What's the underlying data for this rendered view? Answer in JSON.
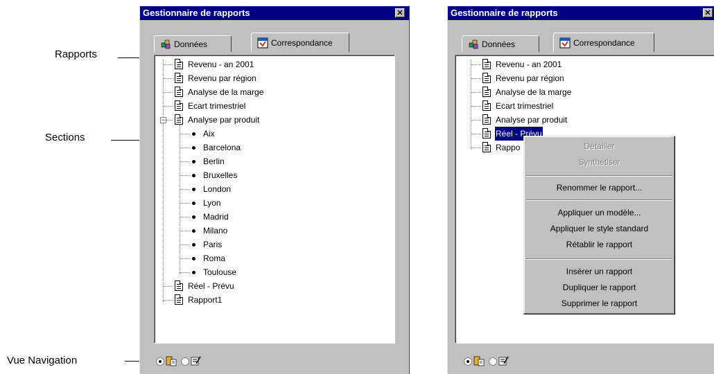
{
  "callouts": {
    "rapports": "Rapports",
    "sections": "Sections",
    "vue_navigation": "Vue Navigation"
  },
  "left_panel": {
    "title": "Gestionnaire de rapports",
    "close_icon": "close-x",
    "tabs": [
      "Données",
      "Correspondance"
    ],
    "active_tab": "Correspondance",
    "reports": [
      "Revenu - an 2001",
      "Revenu par région",
      "Analyse de la marge",
      "Ecart trimestriel",
      "Analyse par produit"
    ],
    "sections": [
      "Aix",
      "Barcelona",
      "Berlin",
      "Bruxelles",
      "London",
      "Lyon",
      "Madrid",
      "Milano",
      "Paris",
      "Roma",
      "Toulouse"
    ],
    "reports_after": [
      "Réel - Prévu",
      "Rapport1"
    ],
    "expander": "−"
  },
  "right_panel": {
    "title": "Gestionnaire de rapports",
    "close_icon": "close-x",
    "tabs": [
      "Données",
      "Correspondance"
    ],
    "active_tab": "Correspondance",
    "reports": [
      "Revenu - an 2001",
      "Revenu par région",
      "Analyse de la marge",
      "Ecart trimestriel",
      "Analyse par produit",
      "Réel - Prévu",
      "Rappo"
    ],
    "selected_report": "Réel - Prévu"
  },
  "context_menu": {
    "groups": [
      [
        {
          "label": "Détailler",
          "disabled": true
        },
        {
          "label": "Synthétiser",
          "disabled": true
        }
      ],
      [
        {
          "label": "Renommer le rapport...",
          "disabled": false
        }
      ],
      [
        {
          "label": "Appliquer un modèle...",
          "disabled": false
        },
        {
          "label": "Appliquer le style standard",
          "disabled": false
        },
        {
          "label": "Rétablir le rapport",
          "disabled": false
        }
      ],
      [
        {
          "label": "Insérer un rapport",
          "disabled": false
        },
        {
          "label": "Dupliquer le rapport",
          "disabled": false
        },
        {
          "label": "Supprimer le rapport",
          "disabled": false
        }
      ]
    ]
  },
  "colors": {
    "title_bar": "#000080",
    "dialog_face": "#c0c0c0",
    "selection": "#000080"
  },
  "icons": {
    "tab_data": "data-cubes-icon",
    "tab_mapping": "mapping-grid-icon",
    "report": "report-document-icon",
    "section": "bullet-icon",
    "nav_view_report": "report-view-icon",
    "nav_view_mapping": "mapping-view-icon"
  }
}
